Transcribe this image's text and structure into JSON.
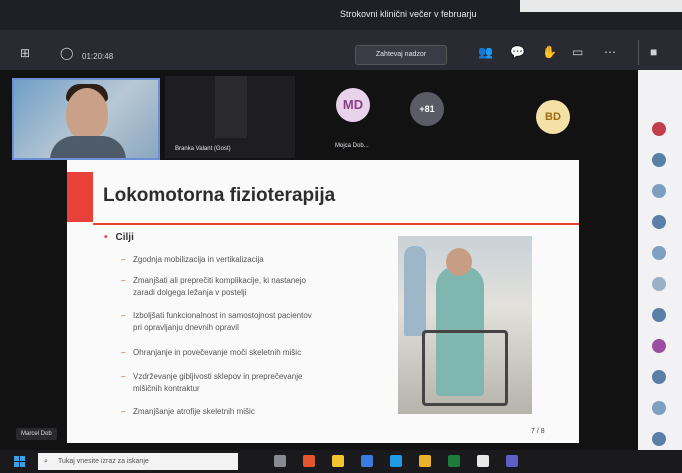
{
  "window": {
    "title": "Strokovni klinični večer v februarju"
  },
  "toolbar": {
    "timer": "01:20:48",
    "share_label": "Zahtevaj nadzor"
  },
  "participants": {
    "self_name": "Marcel Dob",
    "tile1_name": "Branka Valant (Gost)",
    "avatars": [
      {
        "initials": "MD",
        "name": "Mojca Dob...",
        "color": "#e7d3ea",
        "text_color": "#8b3f86"
      },
      {
        "initials": "+81",
        "name": "",
        "color": "#5b5b66",
        "text_color": "#ffffff"
      },
      {
        "initials": "BD",
        "name": "",
        "color": "#f3e1a6",
        "text_color": "#9a6a10"
      }
    ]
  },
  "slide": {
    "title": "Lokomotorna fizioterapija",
    "heading": "Cilji",
    "items": [
      "Zgodnja mobilizacija in vertikalizacija",
      "Zmanjšati ali preprečiti komplikacije, ki nastanejo",
      "zaradi dolgega ležanja v postelji",
      "Izboljšati funkcionalnost in samostojnost pacientov",
      "pri opravljanju dnevnih opravil",
      "Ohranjanje in povečevanje moči skeletnih mišic",
      "Vzdrževanje gibljivosti sklepov in preprečevanje",
      "mišičnih kontraktur",
      "Zmanjšanje atrofije skeletnih mišic"
    ],
    "page": "7 / 8"
  },
  "presenter_tag": "Marcel Dob",
  "taskbar": {
    "search_placeholder": "Tukaj vnesite izraz za iskanje",
    "apps": [
      {
        "name": "task-view-icon",
        "color": "#8a8a92"
      },
      {
        "name": "office-icon",
        "color": "#e2552d"
      },
      {
        "name": "folder-icon",
        "color": "#f4c430"
      },
      {
        "name": "store-icon",
        "color": "#3a7be0"
      },
      {
        "name": "edge-icon",
        "color": "#1f9be6"
      },
      {
        "name": "chrome-icon",
        "color": "#e9b12c"
      },
      {
        "name": "excel-icon",
        "color": "#1f7a3d"
      },
      {
        "name": "word-icon",
        "color": "#e8e8e8"
      },
      {
        "name": "teams-icon",
        "color": "#5b5fc7"
      }
    ]
  },
  "sidebar_colors": [
    "#c13f4a",
    "#5a7fa8",
    "#7ea0c0",
    "#5a7fa8",
    "#7ea0c0",
    "#9ab0c8",
    "#5a7fa8",
    "#9a4fa0",
    "#5a7fa8",
    "#7ea0c0",
    "#5a7fa8"
  ]
}
